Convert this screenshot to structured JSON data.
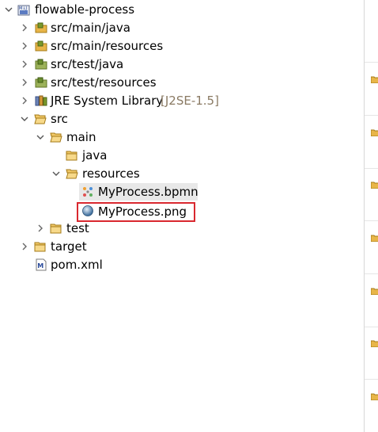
{
  "project": {
    "name": "flowable-process"
  },
  "tree": [
    {
      "label": "src/main/java"
    },
    {
      "label": "src/main/resources"
    },
    {
      "label": "src/test/java"
    },
    {
      "label": "src/test/resources"
    },
    {
      "label": "JRE System Library",
      "decoration": "[J2SE-1.5]"
    },
    {
      "label": "src"
    },
    {
      "label": "main"
    },
    {
      "label": "java"
    },
    {
      "label": "resources"
    },
    {
      "label": "MyProcess.bpmn"
    },
    {
      "label": "MyProcess.png"
    },
    {
      "label": "test"
    },
    {
      "label": "target"
    },
    {
      "label": "pom.xml"
    }
  ],
  "colors": {
    "highlight": "#d9282f",
    "folder": "#e8b548",
    "package": "#6a8e2f"
  }
}
